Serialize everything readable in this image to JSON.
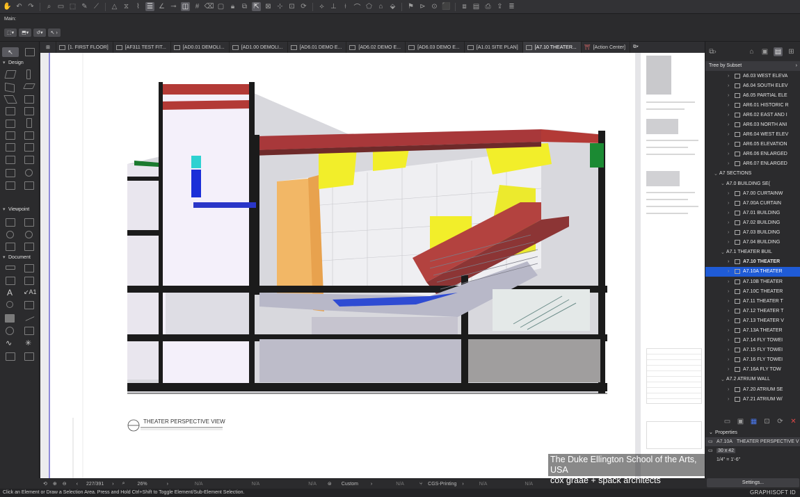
{
  "app": {
    "hint": "Main:",
    "brand": "GRAPHISOFT ID"
  },
  "toolbar": {
    "icons": [
      "hand-icon",
      "undo-icon",
      "redo-icon",
      "find-icon",
      "pen-icon",
      "eyedropper-icon"
    ]
  },
  "tabs": [
    {
      "label": "[1. FIRST FLOOR]"
    },
    {
      "label": "[AF311 TEST FIT..."
    },
    {
      "label": "[AD0.01 DEMOLI..."
    },
    {
      "label": "[AD1.00 DEMOLI..."
    },
    {
      "label": "[AD6.01 DEMO E..."
    },
    {
      "label": "[AD6.02 DEMO E..."
    },
    {
      "label": "[AD6.03 DEMO E..."
    },
    {
      "label": "[A1.01 SITE PLAN]"
    },
    {
      "label": "[A7.10 THEATER..."
    },
    {
      "label": "[Action Center]"
    }
  ],
  "toolbox": {
    "sections": [
      {
        "label": "Design"
      },
      {
        "label": "Viewpoint"
      },
      {
        "label": "Document"
      }
    ]
  },
  "canvas": {
    "view_title": "THEATER PERSPECTIVE VIEW"
  },
  "navigator": {
    "mode": "Tree by Subset",
    "items": [
      {
        "label": "A6.03 WEST ELEVA",
        "chev": "›",
        "indent": 3
      },
      {
        "label": "A6.04 SOUTH ELEV",
        "chev": "›",
        "indent": 3
      },
      {
        "label": "A6.05 PARTIAL ELE",
        "chev": "›",
        "indent": 3
      },
      {
        "label": "AR6.01 HISTORIC R",
        "chev": "›",
        "indent": 3
      },
      {
        "label": "AR6.02 EAST AND I",
        "chev": "›",
        "indent": 3
      },
      {
        "label": "AR6.03 NORTH ANI",
        "chev": "›",
        "indent": 3
      },
      {
        "label": "AR6.04 WEST ELEV",
        "chev": "›",
        "indent": 3
      },
      {
        "label": "AR6.05 ELEVATION",
        "chev": "›",
        "indent": 3
      },
      {
        "label": "AR6.06 ENLARGED",
        "chev": "›",
        "indent": 3
      },
      {
        "label": "AR6.07 ENLARGED",
        "chev": "›",
        "indent": 3
      },
      {
        "label": "A7 SECTIONS",
        "chev": "⌄",
        "indent": 1,
        "folder": true
      },
      {
        "label": "A7.0  BUILDING SE(",
        "chev": "⌄",
        "indent": 2,
        "folder": true
      },
      {
        "label": "A7.00 CURTAINW",
        "chev": "›",
        "indent": 3
      },
      {
        "label": "A7.00A CURTAIN",
        "chev": "›",
        "indent": 3
      },
      {
        "label": "A7.01 BUILDING",
        "chev": "›",
        "indent": 3
      },
      {
        "label": "A7.02 BUILDING",
        "chev": "›",
        "indent": 3
      },
      {
        "label": "A7.03 BUILDING",
        "chev": "›",
        "indent": 3
      },
      {
        "label": "A7.04 BUILDING",
        "chev": "›",
        "indent": 3
      },
      {
        "label": "A7.1 THEATER BUIL",
        "chev": "⌄",
        "indent": 2,
        "folder": true
      },
      {
        "label": "A7.10 THEATER",
        "chev": "›",
        "indent": 3,
        "bold": true
      },
      {
        "label": "A7.10A THEATER",
        "chev": "›",
        "indent": 3,
        "selected": true
      },
      {
        "label": "A7.10B THEATER",
        "chev": "›",
        "indent": 3
      },
      {
        "label": "A7.10C THEATER",
        "chev": "›",
        "indent": 3
      },
      {
        "label": "A7.11 THEATER T",
        "chev": "›",
        "indent": 3
      },
      {
        "label": "A7.12 THEATER T",
        "chev": "›",
        "indent": 3
      },
      {
        "label": "A7.13 THEATER V",
        "chev": "›",
        "indent": 3
      },
      {
        "label": "A7.13A THEATER",
        "chev": "›",
        "indent": 3
      },
      {
        "label": "A7.14 FLY TOWEI",
        "chev": "›",
        "indent": 3
      },
      {
        "label": "A7.15 FLY TOWEI",
        "chev": "›",
        "indent": 3
      },
      {
        "label": "A7.16 FLY TOWEI",
        "chev": "›",
        "indent": 3
      },
      {
        "label": "A7.16A FLY TOW",
        "chev": "›",
        "indent": 3
      },
      {
        "label": "A7.2 ATRIUM WALL",
        "chev": "⌄",
        "indent": 2,
        "folder": true
      },
      {
        "label": "A7.20 ATRIUM SE",
        "chev": "›",
        "indent": 3
      },
      {
        "label": "A7.21 ATRIUM W/",
        "chev": "›",
        "indent": 3
      }
    ]
  },
  "properties": {
    "heading": "Properties",
    "id": "A7.10A",
    "name": "THEATER PERSPECTIVE V",
    "size": "30 x 42",
    "scale": "1/4\" = 1'-6\"",
    "settings_label": "Settings..."
  },
  "statusbar": {
    "page": "227/391",
    "zoom": "26%",
    "na1": "N/A",
    "na2": "N/A",
    "na3": "N/A",
    "custom": "Custom",
    "na4": "N/A",
    "printing": "CGS-Printing",
    "na5": "N/A",
    "na6": "N/A"
  },
  "hint_bar": "Click an Element or Draw a Selection Area. Press and Hold Ctrl+Shift to Toggle Element/Sub-Element Selection.",
  "caption": {
    "line1": "The Duke Ellington School of the Arts, USA",
    "line2": "cox graae + spack architects"
  }
}
